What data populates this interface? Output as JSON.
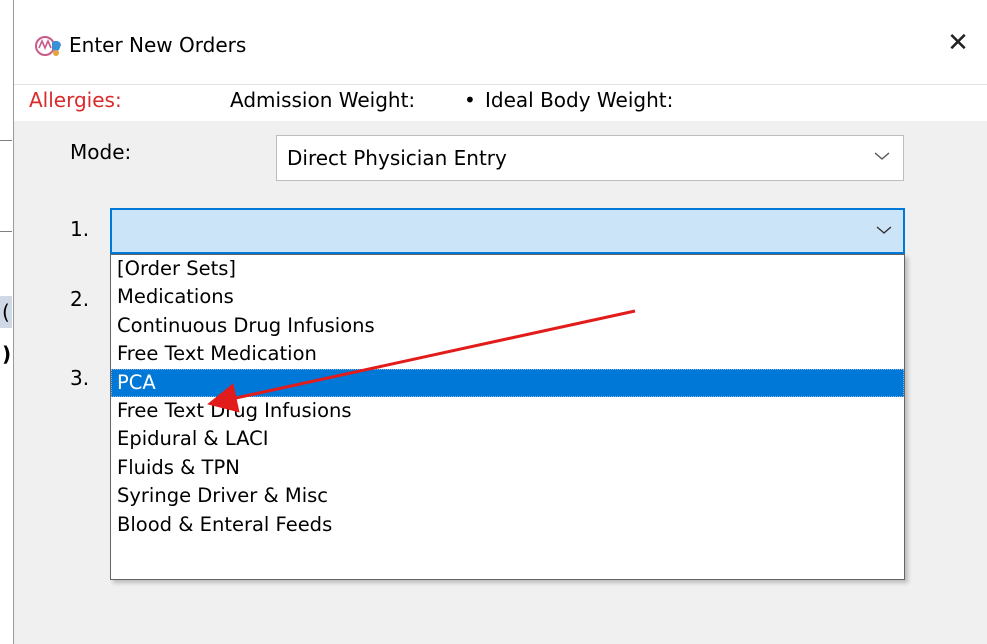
{
  "window": {
    "title": "Enter New Orders",
    "close_glyph": "✕",
    "icon": "app-logo-icon"
  },
  "patient_bar": {
    "allergies_label": "Allergies:",
    "admission_weight_label": "Admission Weight:",
    "separator": "•",
    "ideal_body_weight_label": "Ideal Body Weight:"
  },
  "mode": {
    "label": "Mode:",
    "value": "Direct Physician Entry"
  },
  "order_rows": [
    {
      "number": "1.",
      "value": ""
    },
    {
      "number": "2."
    },
    {
      "number": "3."
    }
  ],
  "order_type_dropdown": {
    "selected": "PCA",
    "options": [
      "[Order Sets]",
      "Medications",
      "Continuous Drug Infusions",
      "Free Text Medication",
      "PCA",
      "Free Text Drug Infusions",
      "Epidural & LACI",
      "Fluids & TPN",
      "Syringe Driver & Misc",
      "Blood & Enteral Feeds"
    ]
  },
  "background_fragments": [
    "(",
    ")"
  ],
  "colors": {
    "accent": "#0078d7",
    "allergy_text": "#d92b2b",
    "selection_bg": "#0078d7",
    "combo_focus_bg": "#cce4f7",
    "annotation_arrow": "#e21b1b"
  }
}
